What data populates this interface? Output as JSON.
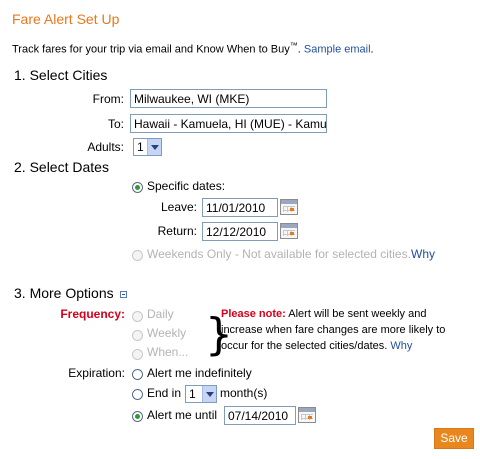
{
  "header": {
    "title": "Fare Alert Set Up"
  },
  "intro": {
    "text": "Track fares for your trip via email and Know When to Buy",
    "trademark": "™",
    "period": ".",
    "link": "Sample email",
    "link_end": "."
  },
  "cities": {
    "heading": "1. Select Cities",
    "from_label": "From:",
    "from_value": "Milwaukee, WI (MKE)",
    "to_label": "To:",
    "to_value": "Hawaii - Kamuela, HI (MUE) - Kamu",
    "adults_label": "Adults:",
    "adults_value": "1"
  },
  "dates": {
    "heading": "2. Select Dates",
    "specific_label": "Specific dates:",
    "leave_label": "Leave:",
    "leave_value": "11/01/2010",
    "return_label": "Return:",
    "return_value": "12/12/2010",
    "weekends_label": "Weekends Only - Not available for selected cities.",
    "why_link": "Why"
  },
  "options": {
    "heading": "3. More Options",
    "frequency_label": "Frequency:",
    "frequency_options": [
      "Daily",
      "Weekly",
      "When..."
    ],
    "note_title": "Please note:",
    "note_text": "Alert will be sent weekly and increase when fare changes are more likely to occur for the selected cities/dates.",
    "why_link": "Why",
    "expiration_label": "Expiration:",
    "indefinitely_label": "Alert me indefinitely",
    "end_in_label": "End in",
    "end_in_value": "1",
    "months_label": "month(s)",
    "until_label": "Alert me until",
    "until_value": "07/14/2010"
  },
  "actions": {
    "save_label": "Save"
  },
  "colors": {
    "accent": "#e8781c",
    "link": "#1f4f9c",
    "warning": "#d4001c"
  }
}
